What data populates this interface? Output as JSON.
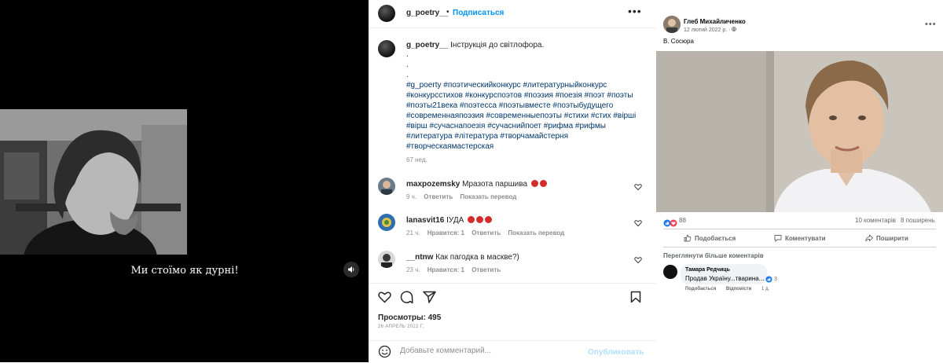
{
  "video": {
    "subtitle": "Ми стоїмо як дурні!",
    "mute_icon": "speaker-icon"
  },
  "instagram": {
    "username": "g_poetry__",
    "separator": "•",
    "follow_label": "Подписаться",
    "more_icon": "more-horizontal-icon",
    "caption": {
      "username": "g_poetry__",
      "text": "Інструкція до світлофора.",
      "bullets": [
        ".",
        ".",
        "."
      ],
      "hashtags": "#g_poerty #поэтическийконкурс #литературныйконкурс #конкурсстихов #конкурспоэтов #поэзия #поезія #поэт #поэты #поэты21века #поэтесса #поэтывместе #поэтыбудущего #современнаяпоэзия #современныепоэты #стихи #стих #вірші #вірш #сучаснапоезія #сучаснийпоет #рифма #рифмы #литература #література #творчамайстерня #творческаямастерская",
      "time": "67 нед."
    },
    "comments": [
      {
        "user": "maxpozemsky",
        "text": "Мразота паршива",
        "emoji_count": 2,
        "time": "9 ч.",
        "likes": "",
        "reply": "Ответить",
        "translate": "Показать перевод"
      },
      {
        "user": "lanasvit16",
        "text": "ІУДА",
        "emoji_count": 3,
        "time": "21 ч.",
        "likes": "Нравится: 1",
        "reply": "Ответить",
        "translate": "Показать перевод"
      },
      {
        "user": "__ntnw",
        "text": "Как пагодка в маскве?)",
        "emoji_count": 0,
        "time": "23 ч.",
        "likes": "Нравится: 1",
        "reply": "Ответить",
        "translate": ""
      }
    ],
    "views": "Просмотры: 495",
    "date": "26 АПРЕЛЬ 2022 Г.",
    "comment_placeholder": "Добавьте комментарий...",
    "publish_label": "Опубликовать"
  },
  "facebook": {
    "author": "Глеб Михайличенко",
    "date": "12 лютий 2022 р. · ",
    "post_text": "В. Сосюра",
    "reactions_count": "88",
    "comments_count": "10 коментарів",
    "shares_count": "8 поширень",
    "actions": {
      "like": "Подобається",
      "comment": "Коментувати",
      "share": "Поширити"
    },
    "more_comments": "Переглянути більше коментарів",
    "comment": {
      "author": "Тамара Редчиць",
      "text": "Продав Україну...тварина...",
      "reactions": "3",
      "like": "Подобається",
      "reply": "Відповісти",
      "time": "1 д."
    }
  },
  "colors": {
    "ig_link": "#00376b",
    "ig_follow": "#0095f6",
    "fb_like": "#1877f2",
    "fb_love": "#f33e58",
    "emoji_red": "#d42b2b"
  }
}
